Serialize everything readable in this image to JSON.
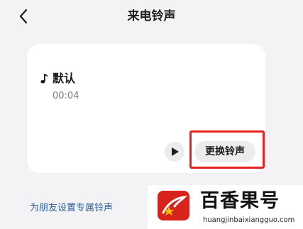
{
  "header": {
    "title": "来电铃声",
    "back_icon": "chevron-left-icon"
  },
  "ringtone": {
    "icon": "music-note-icon",
    "name": "默认",
    "duration": "00:04"
  },
  "controls": {
    "play_icon": "play-icon",
    "change_label": "更换铃声",
    "highlight_color": "#e4231f"
  },
  "friend_link": {
    "label": "为朋友设置专属铃声"
  },
  "watermark": {
    "title": "百香果号",
    "url": "huangjinbaixiangguo.com"
  },
  "colors": {
    "background": "#f3f3f5",
    "card": "#ffffff",
    "link": "#2f5f9c",
    "button_bg": "#ececee"
  }
}
